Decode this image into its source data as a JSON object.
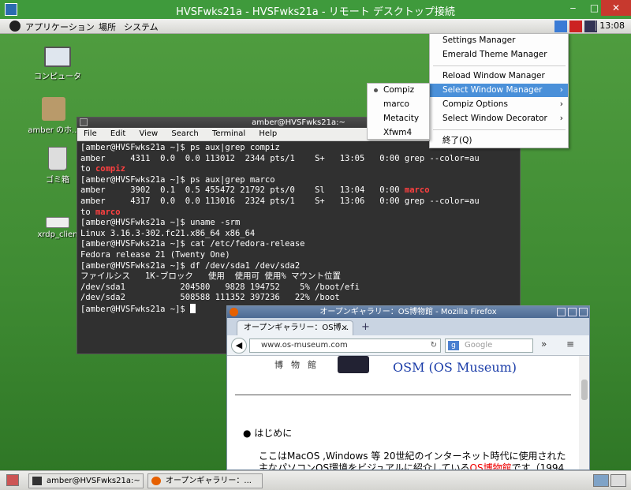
{
  "rdp": {
    "title": "HVSFwks21a - HVSFwks21a - リモート デスクトップ接続",
    "min": "‒",
    "max": "□",
    "close": "✕"
  },
  "panel": {
    "menus": [
      "アプリケーション",
      "場所",
      "システム"
    ],
    "clock": "13:08"
  },
  "desktop_icons": [
    {
      "label": "コンピュータ",
      "icon": "computer-icon"
    },
    {
      "label": "amber のホ...",
      "icon": "home-folder-icon"
    },
    {
      "label": "ゴミ箱",
      "icon": "trash-icon"
    },
    {
      "label": "xrdp_clien",
      "icon": "drive-icon"
    }
  ],
  "terminal": {
    "title": "amber@HVSFwks21a:~",
    "menu": [
      "File",
      "Edit",
      "View",
      "Search",
      "Terminal",
      "Help"
    ],
    "lines": [
      [
        {
          "t": "[amber@HVSFwks21a ~]$ ps aux|grep compiz"
        }
      ],
      [
        {
          "t": "amber     4311  0.0  0.0 113012  2344 pts/1    S+   13:05   0:00 grep --color=au"
        }
      ],
      [
        {
          "t": "to "
        },
        {
          "t": "compiz",
          "c": "red"
        }
      ],
      [
        {
          "t": "[amber@HVSFwks21a ~]$ ps aux|grep marco"
        }
      ],
      [
        {
          "t": "amber     3902  0.1  0.5 455472 21792 pts/0    Sl   13:04   0:00 "
        },
        {
          "t": "marco",
          "c": "red"
        }
      ],
      [
        {
          "t": "amber     4317  0.0  0.0 113016  2324 pts/1    S+   13:06   0:00 grep --color=au"
        }
      ],
      [
        {
          "t": "to "
        },
        {
          "t": "marco",
          "c": "red"
        }
      ],
      [
        {
          "t": "[amber@HVSFwks21a ~]$ uname -srm"
        }
      ],
      [
        {
          "t": "Linux 3.16.3-302.fc21.x86_64 x86_64"
        }
      ],
      [
        {
          "t": "[amber@HVSFwks21a ~]$ cat /etc/fedora-release"
        }
      ],
      [
        {
          "t": "Fedora release 21 (Twenty One)"
        }
      ],
      [
        {
          "t": "[amber@HVSFwks21a ~]$ df /dev/sda1 /dev/sda2"
        }
      ],
      [
        {
          "t": "ファイルシス   1K-ブロック   使用  使用可 使用% マウント位置"
        }
      ],
      [
        {
          "t": "/dev/sda1           204580   9828 194752    5% /boot/efi"
        }
      ],
      [
        {
          "t": "/dev/sda2           508588 111352 397236   22% /boot"
        }
      ],
      [
        {
          "t": "[amber@HVSFwks21a ~]$ "
        },
        {
          "t": "",
          "c": "cursor"
        }
      ]
    ]
  },
  "context_menu": {
    "items": [
      "Settings Manager",
      "Emerald Theme Manager",
      "Reload Window Manager",
      "Select Window Manager",
      "Compiz Options",
      "Select Window Decorator",
      "終了(Q)"
    ],
    "arrow": "›"
  },
  "submenu": {
    "items": [
      "Compiz",
      "marco",
      "Metacity",
      "Xfwm4"
    ]
  },
  "firefox": {
    "title": "オープンギャラリー：OS博物館 - Mozilla Firefox",
    "tab": "オープンギャラリー：OS博...",
    "tab_close": "×",
    "new_tab": "+",
    "url": "www.os-museum.com",
    "search_placeholder": "Google",
    "logo_kanji": "博物館",
    "logo_text": "OSM (OS Museum)",
    "bullet": "●  はじめに",
    "para1": "ここはMacOS ,Windows 等 20世紀のインターネット時代に使用された",
    "para2a": "主なパソコンOS環境をビジュアルに紹介している",
    "para2link": "OS博物館",
    "para2b": "です（1994"
  },
  "taskbar": {
    "tasks": [
      "amber@HVSFwks21a:~",
      "オープンギャラリー：..."
    ]
  }
}
